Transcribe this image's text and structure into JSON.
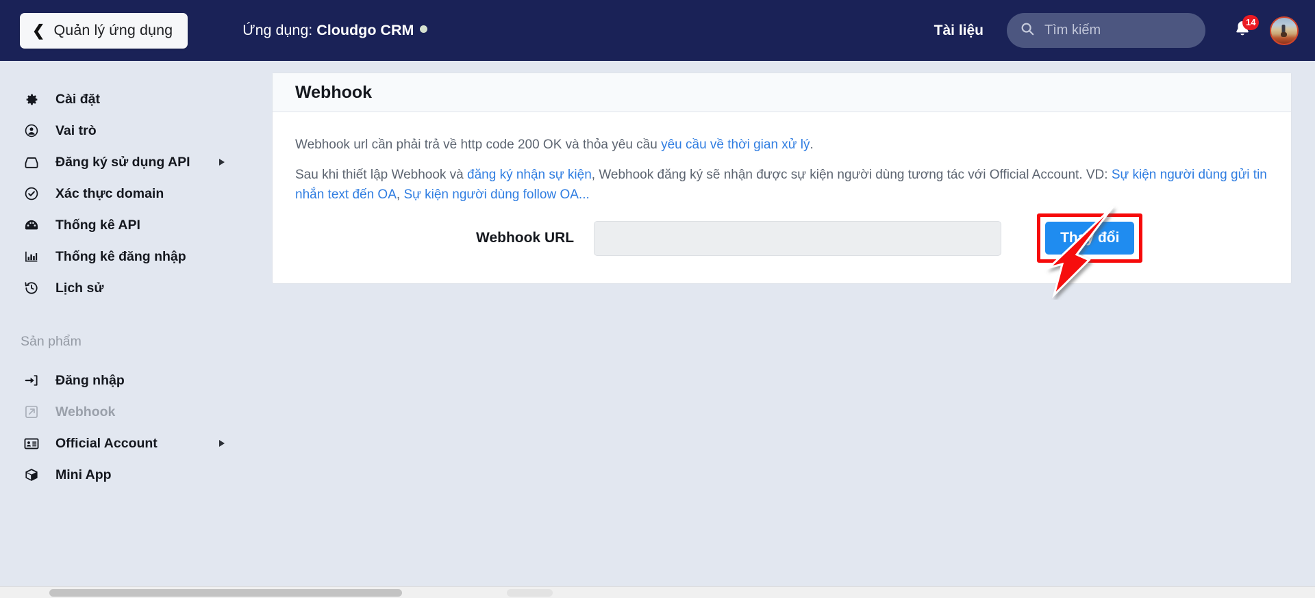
{
  "topbar": {
    "back_button_label": "Quản lý ứng dụng",
    "app_prefix": "Ứng dụng:",
    "app_name": "Cloudgo CRM",
    "docs_label": "Tài liệu",
    "search_placeholder": "Tìm kiếm",
    "notification_count": "14"
  },
  "sidebar": {
    "items": [
      {
        "label": "Cài đặt",
        "icon": "gear-icon",
        "has_caret": false,
        "muted": false
      },
      {
        "label": "Vai trò",
        "icon": "user-circle-icon",
        "has_caret": false,
        "muted": false
      },
      {
        "label": "Đăng ký sử dụng API",
        "icon": "inbox-icon",
        "has_caret": true,
        "muted": false
      },
      {
        "label": "Xác thực domain",
        "icon": "check-circle-icon",
        "has_caret": false,
        "muted": false
      },
      {
        "label": "Thống kê API",
        "icon": "gauge-icon",
        "has_caret": false,
        "muted": false
      },
      {
        "label": "Thống kê đăng nhập",
        "icon": "bar-chart-icon",
        "has_caret": false,
        "muted": false
      },
      {
        "label": "Lịch sử",
        "icon": "history-icon",
        "has_caret": false,
        "muted": false
      }
    ],
    "section_label": "Sản phẩm",
    "product_items": [
      {
        "label": "Đăng nhập",
        "icon": "login-arrow-icon",
        "has_caret": false,
        "muted": false
      },
      {
        "label": "Webhook",
        "icon": "external-link-icon",
        "has_caret": false,
        "muted": true
      },
      {
        "label": "Official Account",
        "icon": "id-card-icon",
        "has_caret": true,
        "muted": false
      },
      {
        "label": "Mini App",
        "icon": "cube-icon",
        "has_caret": false,
        "muted": false
      }
    ]
  },
  "card": {
    "title": "Webhook",
    "paragraph1": {
      "part1": "Webhook url cần phải trả về http code 200 OK và thỏa yêu cầu ",
      "link1": "yêu cầu về thời gian xử lý",
      "part2": "."
    },
    "paragraph2": {
      "part1": "Sau khi thiết lập Webhook và ",
      "link1": "đăng ký nhận sự kiện",
      "part2": ", Webhook đăng ký sẽ nhận được sự kiện người dùng tương tác với Official Account. VD: ",
      "link2": "Sự kiện người dùng gửi tin nhắn text đến OA",
      "part3": ", ",
      "link3": "Sự kiện người dùng follow OA..."
    },
    "form": {
      "label": "Webhook URL",
      "input_value": "",
      "input_placeholder": "",
      "submit_label": "Thay đổi"
    }
  },
  "colors": {
    "topbar_bg": "#1a2257",
    "page_bg": "#e2e7f0",
    "accent_blue": "#1f8cf0",
    "link_blue": "#2f7de1",
    "annotation_red": "#f60a0a",
    "badge_red": "#ea1b23"
  }
}
